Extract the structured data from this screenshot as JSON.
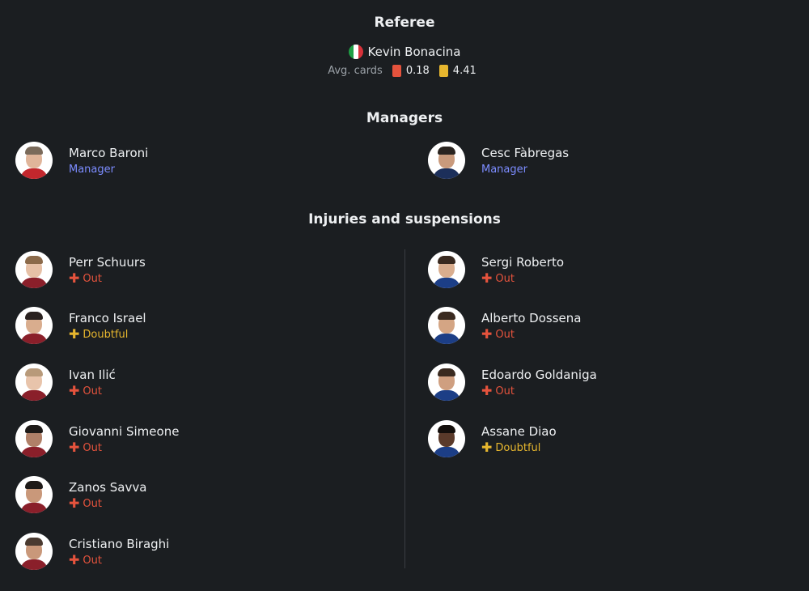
{
  "colors": {
    "background": "#1b1e21",
    "text": "#eef0f2",
    "muted": "#9aa0a6",
    "manager_role": "#7c8cff",
    "out": "#e5533d",
    "doubtful": "#e6b62e",
    "red_card": "#e5533d",
    "yellow_card": "#e6b62e"
  },
  "referee": {
    "title": "Referee",
    "name": "Kevin Bonacina",
    "flag_icon": "italy-flag-icon",
    "avg_label": "Avg. cards",
    "red_avg": "0.18",
    "yellow_avg": "4.41"
  },
  "managers": {
    "title": "Managers",
    "home": {
      "name": "Marco Baroni",
      "role": "Manager"
    },
    "away": {
      "name": "Cesc Fàbregas",
      "role": "Manager"
    }
  },
  "injuries": {
    "title": "Injuries and suspensions",
    "home": [
      {
        "name": "Perr Schuurs",
        "status": "Out"
      },
      {
        "name": "Franco Israel",
        "status": "Doubtful"
      },
      {
        "name": "Ivan Ilić",
        "status": "Out"
      },
      {
        "name": "Giovanni Simeone",
        "status": "Out"
      },
      {
        "name": "Zanos Savva",
        "status": "Out"
      },
      {
        "name": "Cristiano Biraghi",
        "status": "Out"
      }
    ],
    "away": [
      {
        "name": "Sergi Roberto",
        "status": "Out"
      },
      {
        "name": "Alberto Dossena",
        "status": "Out"
      },
      {
        "name": "Edoardo Goldaniga",
        "status": "Out"
      },
      {
        "name": "Assane Diao",
        "status": "Doubtful"
      }
    ]
  }
}
